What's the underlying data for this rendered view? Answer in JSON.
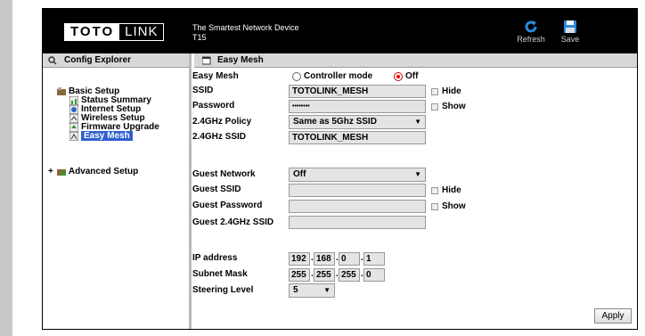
{
  "header": {
    "logo_left": "TOTO",
    "logo_right": "LINK",
    "tagline": "The Smartest Network Device",
    "model": "T15",
    "refresh_label": "Refresh",
    "save_label": "Save"
  },
  "sidebar": {
    "title": "Config Explorer",
    "basic_setup": "Basic Setup",
    "items": [
      "Status Summary",
      "Internet Setup",
      "Wireless Setup",
      "Firmware Upgrade",
      "Easy Mesh"
    ],
    "advanced_setup": "Advanced Setup",
    "expand_symbol": "+"
  },
  "main": {
    "title": "Easy Mesh",
    "easy_mesh_label": "Easy Mesh",
    "radio_controller": "Controller mode",
    "radio_off": "Off",
    "ssid_label": "SSID",
    "ssid_value": "TOTOLINK_MESH",
    "hide_label": "Hide",
    "password_label": "Password",
    "password_value": "••••••••",
    "show_label": "Show",
    "policy_label": "2.4GHz Policy",
    "policy_value": "Same as 5Ghz SSID",
    "ssid24_label": "2.4GHz SSID",
    "ssid24_value": "TOTOLINK_MESH",
    "guest_network_label": "Guest Network",
    "guest_network_value": "Off",
    "guest_ssid_label": "Guest SSID",
    "guest_ssid_value": "",
    "guest_hide_label": "Hide",
    "guest_password_label": "Guest Password",
    "guest_password_value": "",
    "guest_show_label": "Show",
    "guest_ssid24_label": "Guest 2.4GHz SSID",
    "guest_ssid24_value": "",
    "ip_label": "IP address",
    "ip": [
      "192",
      "168",
      "0",
      "1"
    ],
    "mask_label": "Subnet Mask",
    "mask": [
      "255",
      "255",
      "255",
      "0"
    ],
    "steering_label": "Steering Level",
    "steering_value": "5",
    "apply_label": "Apply"
  }
}
